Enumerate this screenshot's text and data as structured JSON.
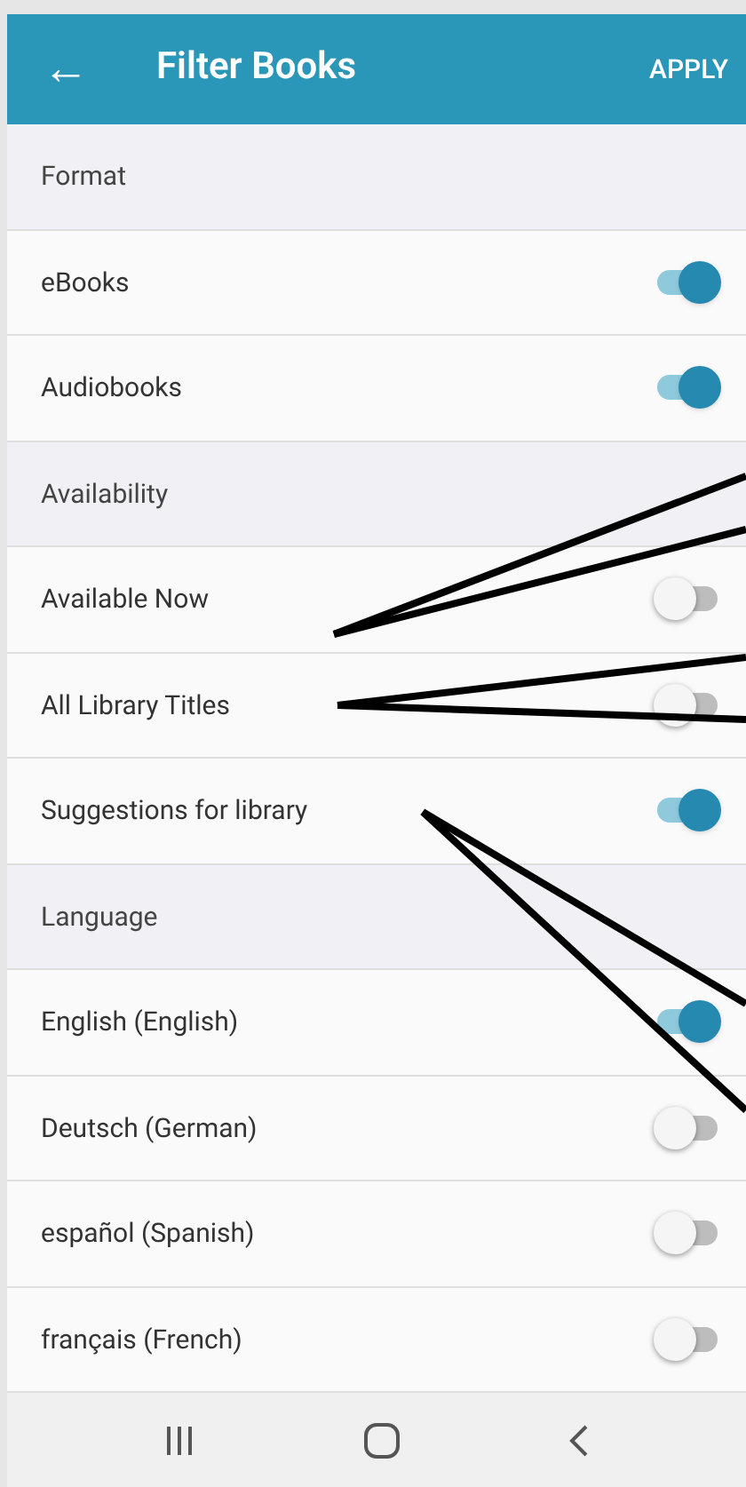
{
  "header": {
    "back": "←",
    "title": "Filter Books",
    "action": "APPLY"
  },
  "list": [
    {
      "kind": "section",
      "label": "Format"
    },
    {
      "kind": "toggle",
      "label": "eBooks",
      "on": true
    },
    {
      "kind": "toggle",
      "label": "Audiobooks",
      "on": true
    },
    {
      "kind": "section",
      "label": "Availability"
    },
    {
      "kind": "toggle",
      "label": "Available Now",
      "on": false
    },
    {
      "kind": "toggle",
      "label": "All Library Titles",
      "on": false
    },
    {
      "kind": "toggle",
      "label": "Suggestions for library",
      "on": true
    },
    {
      "kind": "section",
      "label": "Language"
    },
    {
      "kind": "toggle",
      "label": "English (English)",
      "on": true
    },
    {
      "kind": "toggle",
      "label": "Deutsch (German)",
      "on": false
    },
    {
      "kind": "toggle",
      "label": "español (Spanish)",
      "on": false
    },
    {
      "kind": "toggle",
      "label": "français (French)",
      "on": false
    }
  ]
}
